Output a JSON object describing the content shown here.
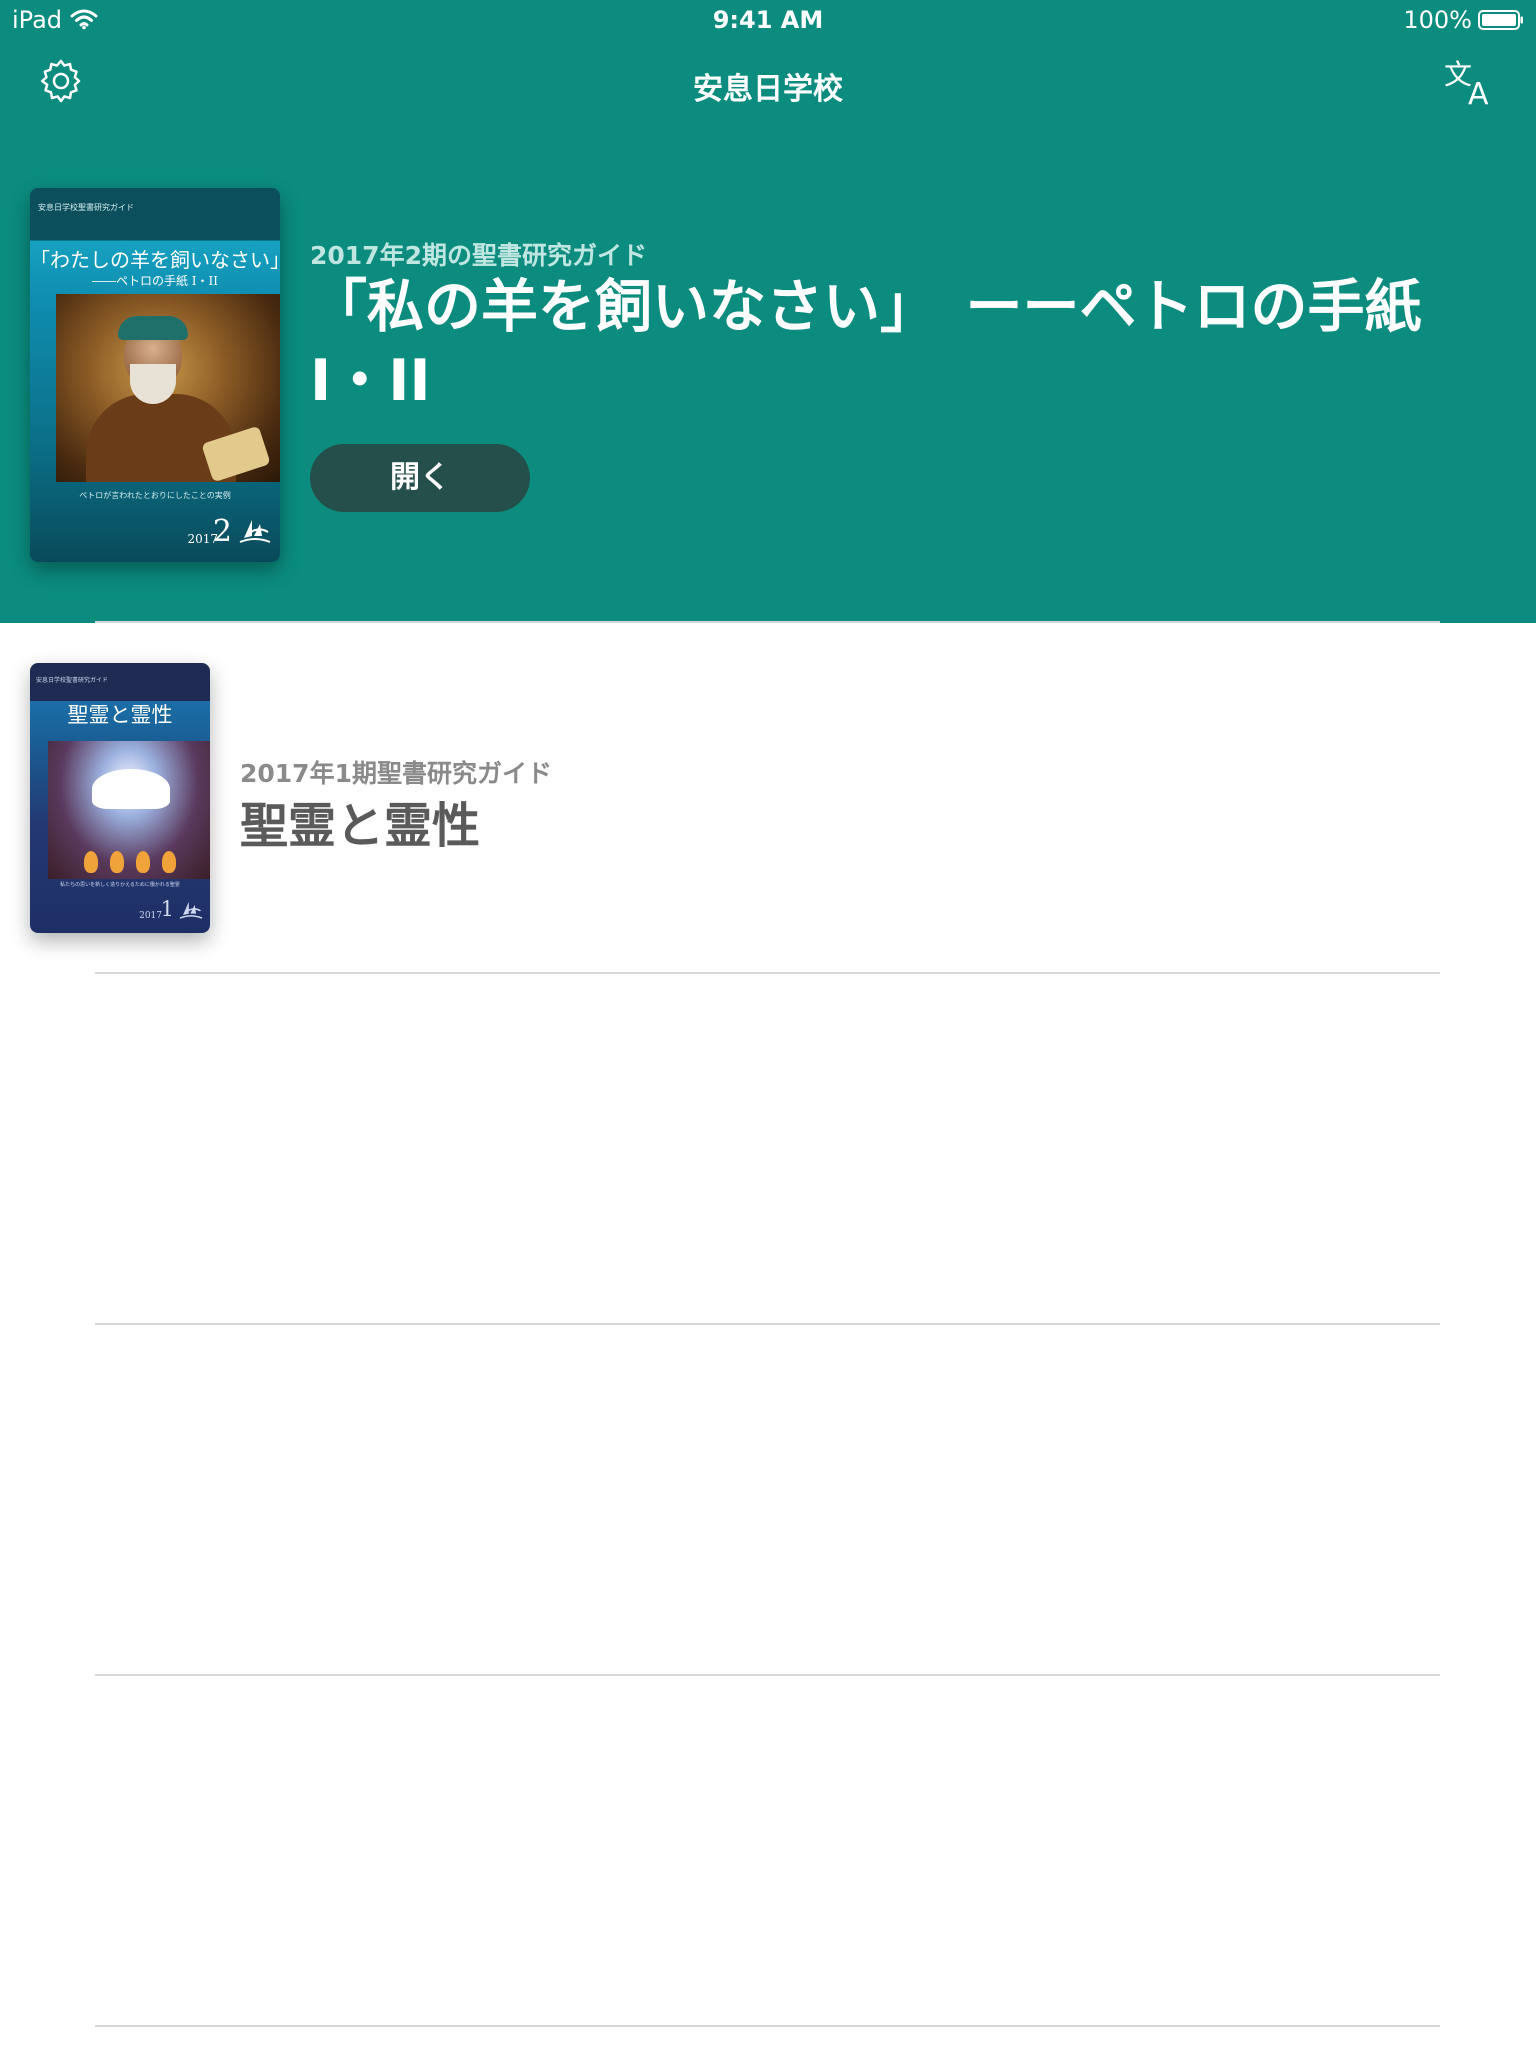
{
  "status_bar": {
    "device": "iPad",
    "time": "9:41 AM",
    "battery": "100%"
  },
  "nav": {
    "title": "安息日学校",
    "settings_icon": "gear-icon",
    "language_icon": "translate-icon"
  },
  "colors": {
    "header_bg": "#0b8c7f",
    "button_bg": "#244f4a",
    "divider": "#d6d6d6"
  },
  "featured": {
    "subtitle": "2017年2期の聖書研究ガイド",
    "title": "「私の羊を飼いなさい」　ーーペトロの手紙I・II",
    "open_button": "開く",
    "cover": {
      "publisher": "安息日学校聖書研究ガイド",
      "title": "「わたしの羊を飼いなさい」",
      "subtitle": "――ペトロの手紙 I・II",
      "caption": "ペトロが言われたとおりにしたことの実例",
      "year": "2017",
      "quarter": "2"
    }
  },
  "quarterlies": [
    {
      "subtitle": "2017年1期聖書研究ガイド",
      "title": "聖霊と霊性",
      "cover": {
        "publisher": "安息日学校聖書研究ガイド",
        "title": "聖霊と霊性",
        "caption": "私たちの思いを新しく造りかえるために働かれる聖霊",
        "year": "2017",
        "quarter": "1"
      }
    }
  ]
}
